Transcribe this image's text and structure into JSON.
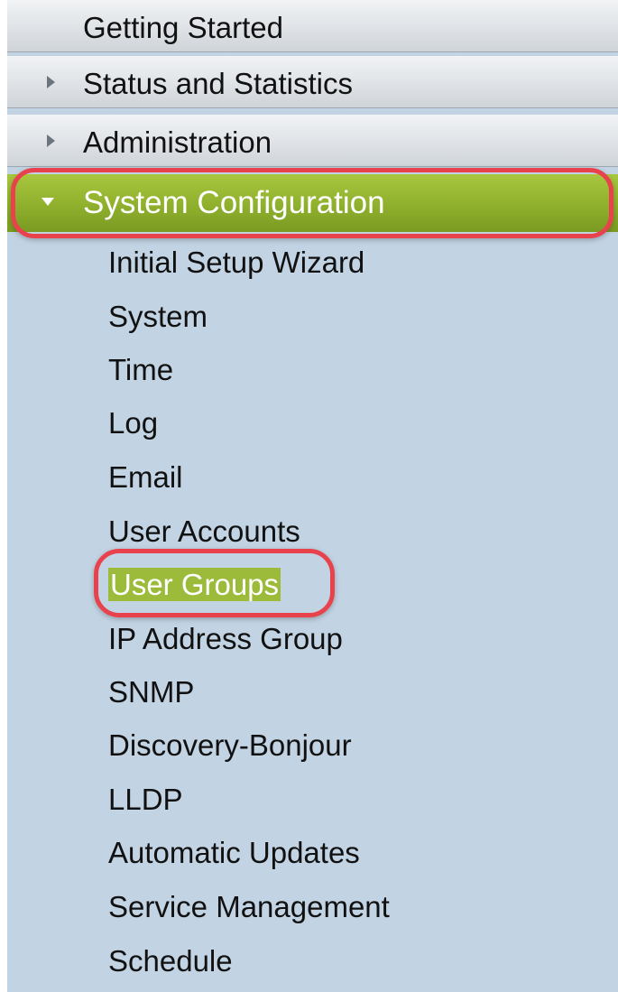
{
  "nav": {
    "top_items": [
      {
        "label": "Getting Started",
        "has_arrow": false
      },
      {
        "label": "Status and Statistics",
        "has_arrow": true
      },
      {
        "label": "Administration",
        "has_arrow": true
      }
    ],
    "active_section": {
      "label": "System Configuration",
      "expanded": true,
      "sub_items": [
        {
          "label": "Initial Setup Wizard"
        },
        {
          "label": "System"
        },
        {
          "label": "Time"
        },
        {
          "label": "Log"
        },
        {
          "label": "Email"
        },
        {
          "label": "User Accounts"
        },
        {
          "label": "User Groups",
          "selected": true
        },
        {
          "label": "IP Address Group"
        },
        {
          "label": "SNMP"
        },
        {
          "label": "Discovery-Bonjour"
        },
        {
          "label": "LLDP"
        },
        {
          "label": "Automatic Updates"
        },
        {
          "label": "Service Management"
        },
        {
          "label": "Schedule"
        }
      ]
    }
  },
  "colors": {
    "nav_background": "#c2d3e3",
    "active_green": "#8fb02d",
    "annotation_red": "#e8424d"
  },
  "icons": {
    "collapsed": "triangle-right-icon",
    "expanded": "triangle-down-icon"
  }
}
